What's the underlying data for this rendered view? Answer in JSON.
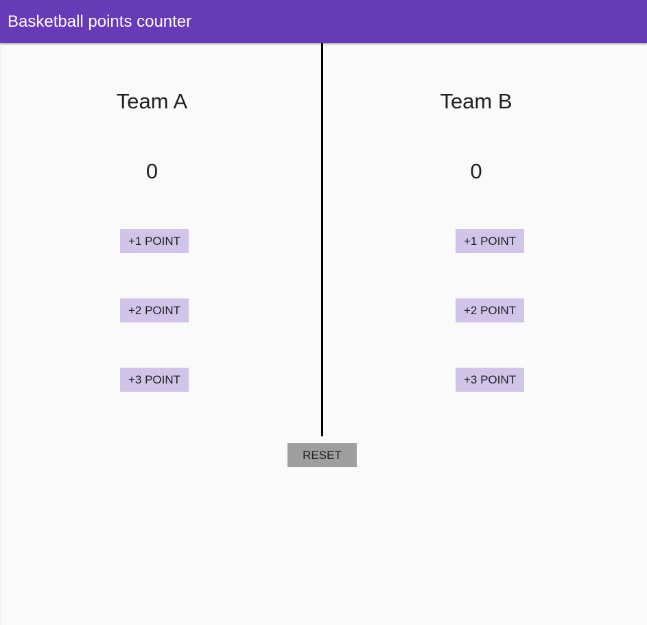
{
  "app_bar": {
    "title": "Basketball points counter",
    "color": "#673ab7"
  },
  "teams": [
    {
      "name": "Team A",
      "score": "0",
      "buttons": [
        "+1 POINT",
        "+2 POINT",
        "+3 POINT"
      ]
    },
    {
      "name": "Team B",
      "score": "0",
      "buttons": [
        "+1 POINT",
        "+2 POINT",
        "+3 POINT"
      ]
    }
  ],
  "reset_label": "RESET",
  "colors": {
    "point_button": "#d1c4e9",
    "reset_button": "#9e9e9e",
    "divider": "#000000",
    "background": "#fafafa"
  }
}
